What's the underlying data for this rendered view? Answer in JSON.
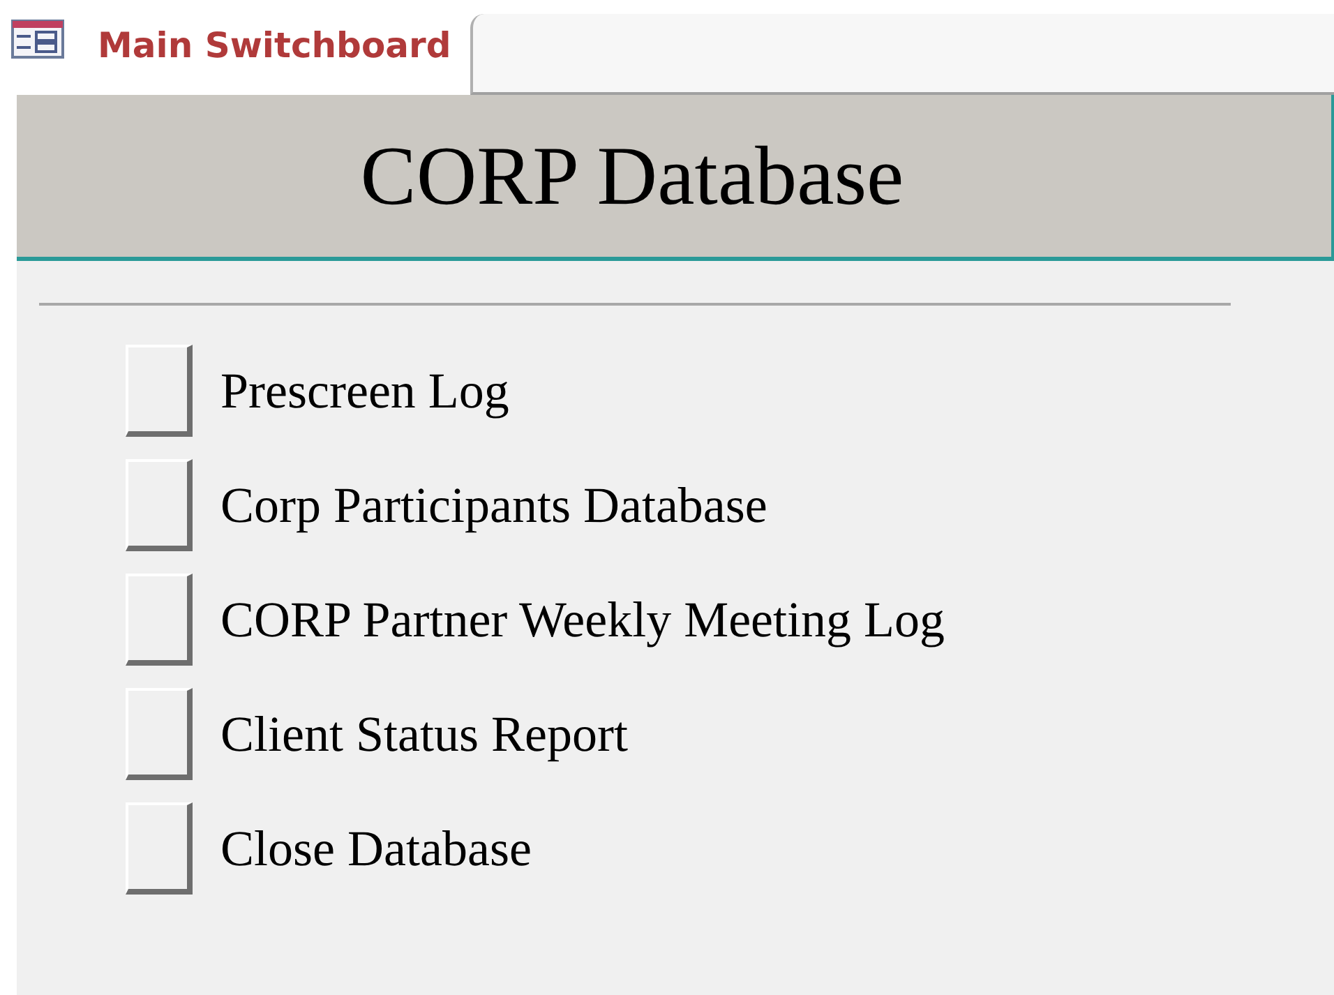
{
  "tab": {
    "label": "Main Switchboard"
  },
  "header": {
    "title": "CORP Database"
  },
  "items": [
    {
      "label": "Prescreen Log"
    },
    {
      "label": "Corp Participants Database"
    },
    {
      "label": "CORP Partner Weekly Meeting Log"
    },
    {
      "label": "Client Status Report"
    },
    {
      "label": "Close Database"
    }
  ]
}
